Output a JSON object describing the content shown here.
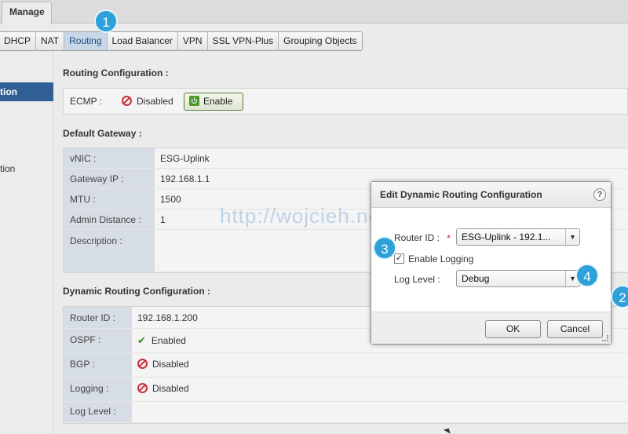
{
  "manage_tab": "Manage",
  "subtabs": [
    "DHCP",
    "NAT",
    "Routing",
    "Load Balancer",
    "VPN",
    "SSL VPN-Plus",
    "Grouping Objects"
  ],
  "leftnav": [
    "tion",
    "tion"
  ],
  "routing_config": {
    "title": "Routing Configuration :",
    "ecmp_label": "ECMP :",
    "ecmp_status": "Disabled",
    "enable_button": "Enable"
  },
  "default_gateway": {
    "title": "Default Gateway :",
    "rows": [
      {
        "label": "vNIC :",
        "value": "ESG-Uplink"
      },
      {
        "label": "Gateway IP :",
        "value": "192.168.1.1"
      },
      {
        "label": "MTU :",
        "value": "1500"
      },
      {
        "label": "Admin Distance :",
        "value": "1"
      },
      {
        "label": "Description :",
        "value": ""
      }
    ]
  },
  "dynamic_routing": {
    "title": "Dynamic Routing Configuration :",
    "rows": [
      {
        "label": "Router ID :",
        "value": "192.168.1.200"
      },
      {
        "label": "OSPF :",
        "value": "Enabled"
      },
      {
        "label": "BGP :",
        "value": "Disabled"
      },
      {
        "label": "Logging :",
        "value": "Disabled"
      },
      {
        "label": "Log Level :",
        "value": ""
      }
    ]
  },
  "dialog": {
    "title": "Edit Dynamic Routing Configuration",
    "help": "?",
    "router_id_label": "Router ID :",
    "required_mark": "*",
    "router_id_value": "ESG-Uplink - 192.1...",
    "enable_logging_label": "Enable Logging",
    "enable_logging_checked": true,
    "log_level_label": "Log Level :",
    "log_level_value": "Debug",
    "ok_button": "OK",
    "cancel_button": "Cancel"
  },
  "callouts": [
    "1",
    "2",
    "3",
    "4"
  ],
  "watermark": "http://wojcieh.net",
  "colors": {
    "accent_blue": "#2f5f93",
    "callout": "#2ea0da",
    "error_red": "#c8303a",
    "success_green": "#3a8d2e"
  },
  "icons": {
    "disabled": "prohibited-icon",
    "enabled": "checkmark-icon",
    "enable": "power-icon",
    "dropdown": "chevron-down-icon",
    "help": "help-icon"
  }
}
